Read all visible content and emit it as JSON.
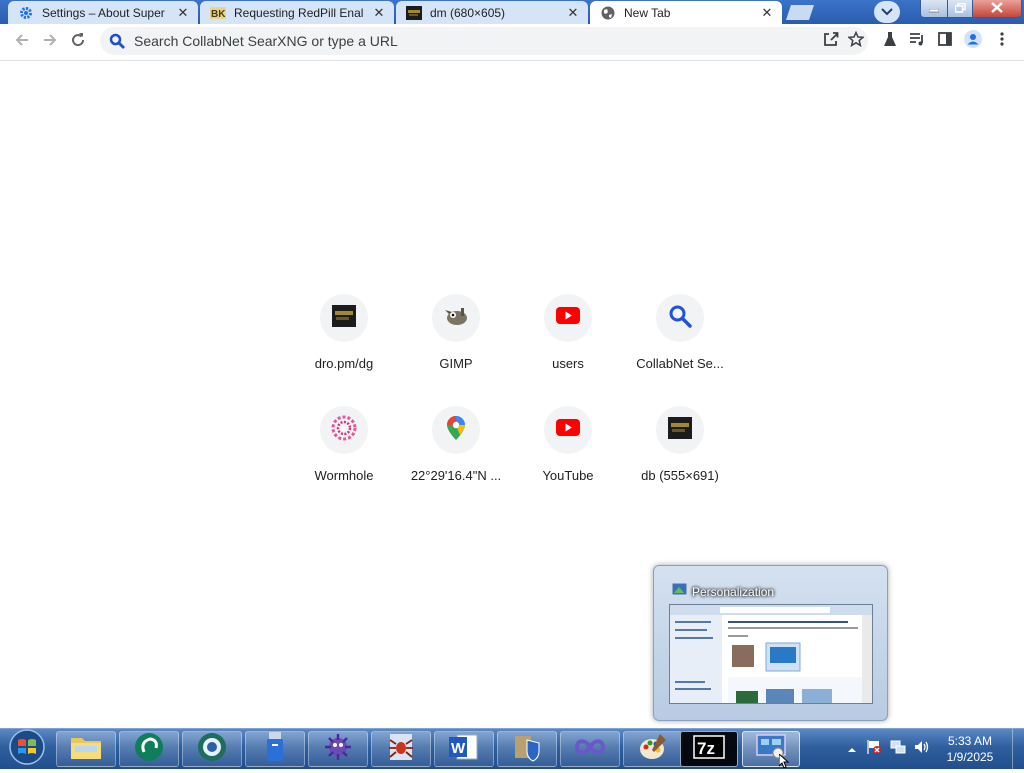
{
  "tabs": [
    {
      "title": "Settings – About Super",
      "icon": "gear-icon"
    },
    {
      "title": "Requesting RedPill Enal",
      "icon": "forum-icon"
    },
    {
      "title": "dm (680×605)",
      "icon": "image-thumb-icon"
    },
    {
      "title": "New Tab",
      "icon": "globe-icon"
    }
  ],
  "toolbar": {
    "omnibox_placeholder": "Search CollabNet SearXNG or type a URL"
  },
  "shortcuts": [
    {
      "label": "dro.pm/dg",
      "icon": "dark-image-icon"
    },
    {
      "label": "GIMP",
      "icon": "gimp-icon"
    },
    {
      "label": "users",
      "icon": "youtube-icon"
    },
    {
      "label": "CollabNet Se...",
      "icon": "search-icon"
    },
    {
      "label": "Wormhole",
      "icon": "wormhole-icon"
    },
    {
      "label": "22°29'16.4\"N ...",
      "icon": "maps-pin-icon"
    },
    {
      "label": "YouTube",
      "icon": "youtube-icon"
    },
    {
      "label": "db (555×691)",
      "icon": "dark-image-icon"
    }
  ],
  "preview": {
    "title": "Personalization"
  },
  "taskbar": {
    "clock_time": "5:33 AM",
    "clock_date": "1/9/2025",
    "buttons": [
      "file-explorer",
      "cabbage-app",
      "globe-browser",
      "usb-tool",
      "bug-virus-app",
      "spider-app",
      "word-app",
      "shield-app",
      "infinity-app",
      "paint-app",
      "7zip-app",
      "personalization-app"
    ]
  },
  "colors": {
    "accent": "#1a73e8",
    "youtube": "#ff0000",
    "taskbar": "#2f5f9f"
  }
}
